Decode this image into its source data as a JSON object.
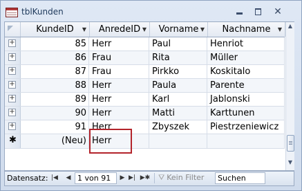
{
  "window": {
    "title": "tblKunden",
    "icon": "table-icon",
    "controls": {
      "minimize": "minimize-icon",
      "maximize": "maximize-icon",
      "close": "✕"
    }
  },
  "columns": [
    "KundeID",
    "AnredeID",
    "Vorname",
    "Nachname"
  ],
  "rows": [
    {
      "expander": "+",
      "kundeid": "85",
      "anrede": "Herr",
      "vorname": "Paul",
      "nachname": "Henriot"
    },
    {
      "expander": "+",
      "kundeid": "86",
      "anrede": "Frau",
      "vorname": "Rita",
      "nachname": "Müller"
    },
    {
      "expander": "+",
      "kundeid": "87",
      "anrede": "Frau",
      "vorname": "Pirkko",
      "nachname": "Koskitalo"
    },
    {
      "expander": "+",
      "kundeid": "88",
      "anrede": "Herr",
      "vorname": "Paula",
      "nachname": "Parente"
    },
    {
      "expander": "+",
      "kundeid": "89",
      "anrede": "Herr",
      "vorname": "Karl",
      "nachname": "Jablonski"
    },
    {
      "expander": "+",
      "kundeid": "90",
      "anrede": "Herr",
      "vorname": "Matti",
      "nachname": "Karttunen"
    },
    {
      "expander": "+",
      "kundeid": "91",
      "anrede": "Herr",
      "vorname": "Zbyszek",
      "nachname": "Piestrzeniewicz"
    }
  ],
  "new_row": {
    "marker": "✱",
    "kundeid": "(Neu)",
    "anrede": "Herr",
    "vorname": "",
    "nachname": ""
  },
  "navigation": {
    "label": "Datensatz:",
    "first": "|◀",
    "prev": "◀",
    "record": "1 von 91",
    "next": "▶",
    "last": "▶|",
    "new": "▶✱",
    "filter_icon": "filter-icon",
    "filter_label": "Kein Filter",
    "search_placeholder": "Suchen"
  },
  "colors": {
    "focus_border": "#b3242b",
    "title_text": "#1e395b",
    "chrome": "#cfdbec"
  }
}
